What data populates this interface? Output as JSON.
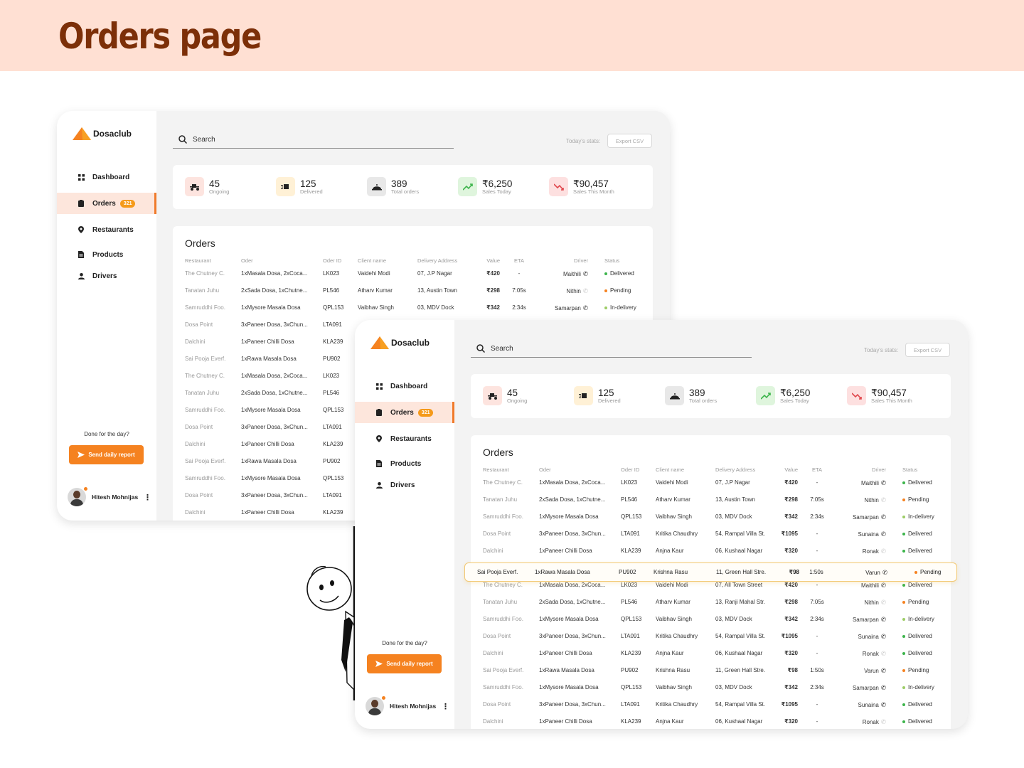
{
  "page_title": "Orders page",
  "app": {
    "brand": "Dosaclub",
    "search_placeholder": "Search",
    "stats_label": "Today's stats:",
    "export_label": "Export CSV",
    "done_text": "Done for the day?",
    "report_label": "Send daily report",
    "user_name": "Hitesh Mohnijas",
    "nav": [
      {
        "label": "Dashboard",
        "icon": "grid-icon"
      },
      {
        "label": "Orders",
        "icon": "clipboard-icon",
        "badge": "321"
      },
      {
        "label": "Restaurants",
        "icon": "location-pin-icon"
      },
      {
        "label": "Products",
        "icon": "document-icon"
      },
      {
        "label": "Drivers",
        "icon": "person-icon"
      }
    ],
    "stats": [
      {
        "value": "45",
        "label": "Ongoing",
        "icon": "scooter-icon",
        "bg": "#fde4df"
      },
      {
        "value": "125",
        "label": "Delivered",
        "icon": "delivery-box-icon",
        "bg": "#fff1d6"
      },
      {
        "value": "389",
        "label": "Total orders",
        "icon": "cloche-icon",
        "bg": "#e8e8e8"
      },
      {
        "value": "₹6,250",
        "label": "Sales Today",
        "icon": "trend-up-icon",
        "bg": "#dff5dd"
      },
      {
        "value": "₹90,457",
        "label": "Sales This Month",
        "icon": "trend-down-icon",
        "bg": "#fde0e0"
      }
    ],
    "orders_title": "Orders",
    "columns": [
      "Restaurant",
      "Oder",
      "Oder ID",
      "Client name",
      "Delivery Address",
      "Value",
      "ETA",
      "Driver",
      "Status"
    ],
    "status_colors": {
      "Delivered": "#3cb44b",
      "Pending": "#f58220",
      "In-delivery": "#9ccc65"
    }
  },
  "window1_rows": [
    {
      "restaurant": "The Chutney C.",
      "order": "1xMasala Dosa, 2xCoca...",
      "id": "LK023",
      "client": "Vaidehi Modi",
      "address": "07, J.P Nagar",
      "value": "₹420",
      "eta": "-",
      "driver": "Maithili",
      "phone_active": true,
      "status": "Delivered"
    },
    {
      "restaurant": "Tanatan Juhu",
      "order": "2xSada Dosa, 1xChutne...",
      "id": "PL546",
      "client": "Atharv Kumar",
      "address": "13, Austin Town",
      "value": "₹298",
      "eta": "7:05s",
      "driver": "Nithin",
      "phone_active": false,
      "status": "Pending"
    },
    {
      "restaurant": "Samruddhi Foo.",
      "order": "1xMysore Masala Dosa",
      "id": "QPL153",
      "client": "Vaibhav Singh",
      "address": "03, MDV Dock",
      "value": "₹342",
      "eta": "2:34s",
      "driver": "Samarpan",
      "phone_active": true,
      "status": "In-delivery"
    },
    {
      "restaurant": "Dosa Point",
      "order": "3xPaneer Dosa, 3xChun...",
      "id": "LTA091"
    },
    {
      "restaurant": "Dalchini",
      "order": "1xPaneer Chilli Dosa",
      "id": "KLA239"
    },
    {
      "restaurant": "Sai Pooja Everf.",
      "order": "1xRawa Masala Dosa",
      "id": "PU902"
    },
    {
      "restaurant": "The Chutney C.",
      "order": "1xMasala Dosa, 2xCoca...",
      "id": "LK023"
    },
    {
      "restaurant": "Tanatan Juhu",
      "order": "2xSada Dosa, 1xChutne...",
      "id": "PL546"
    },
    {
      "restaurant": "Samruddhi Foo.",
      "order": "1xMysore Masala Dosa",
      "id": "QPL153"
    },
    {
      "restaurant": "Dosa Point",
      "order": "3xPaneer Dosa, 3xChun...",
      "id": "LTA091"
    },
    {
      "restaurant": "Dalchini",
      "order": "1xPaneer Chilli Dosa",
      "id": "KLA239"
    },
    {
      "restaurant": "Sai Pooja Everf.",
      "order": "1xRawa Masala Dosa",
      "id": "PU902"
    },
    {
      "restaurant": "Samruddhi Foo.",
      "order": "1xMysore Masala Dosa",
      "id": "QPL153"
    },
    {
      "restaurant": "Dosa Point",
      "order": "3xPaneer Dosa, 3xChun...",
      "id": "LTA091"
    },
    {
      "restaurant": "Dalchini",
      "order": "1xPaneer Chilli Dosa",
      "id": "KLA239"
    }
  ],
  "window2_rows": [
    {
      "restaurant": "The Chutney C.",
      "order": "1xMasala Dosa, 2xCoca...",
      "id": "LK023",
      "client": "Vaidehi Modi",
      "address": "07, J.P Nagar",
      "value": "₹420",
      "eta": "-",
      "driver": "Maithili",
      "phone_active": true,
      "status": "Delivered"
    },
    {
      "restaurant": "Tanatan Juhu",
      "order": "2xSada Dosa, 1xChutne...",
      "id": "PL546",
      "client": "Atharv Kumar",
      "address": "13, Austin Town",
      "value": "₹298",
      "eta": "7:05s",
      "driver": "Nithin",
      "phone_active": false,
      "status": "Pending"
    },
    {
      "restaurant": "Samruddhi Foo.",
      "order": "1xMysore Masala Dosa",
      "id": "QPL153",
      "client": "Vaibhav Singh",
      "address": "03, MDV Dock",
      "value": "₹342",
      "eta": "2:34s",
      "driver": "Samarpan",
      "phone_active": true,
      "status": "In-delivery"
    },
    {
      "restaurant": "Dosa Point",
      "order": "3xPaneer Dosa, 3xChun...",
      "id": "LTA091",
      "client": "Kritika Chaudhry",
      "address": "54, Rampal Villa St.",
      "value": "₹1095",
      "eta": "-",
      "driver": "Sunaina",
      "phone_active": true,
      "status": "Delivered"
    },
    {
      "restaurant": "Dalchini",
      "order": "1xPaneer Chilli Dosa",
      "id": "KLA239",
      "client": "Anjna Kaur",
      "address": "06, Kushaal Nagar",
      "value": "₹320",
      "eta": "-",
      "driver": "Ronak",
      "phone_active": false,
      "status": "Delivered"
    },
    {
      "restaurant": "",
      "order": "",
      "id": "",
      "client": "",
      "address": "",
      "value": "",
      "eta": "",
      "driver": "",
      "status": ""
    },
    {
      "restaurant": "The Chutney C.",
      "order": "1xMasala Dosa, 2xCoca...",
      "id": "LK023",
      "client": "Vaidehi Modi",
      "address": "07, All Town Street",
      "value": "₹420",
      "eta": "-",
      "driver": "Maithili",
      "phone_active": true,
      "status": "Delivered"
    },
    {
      "restaurant": "Tanatan Juhu",
      "order": "2xSada Dosa, 1xChutne...",
      "id": "PL546",
      "client": "Atharv Kumar",
      "address": "13, Ranji Mahal Str.",
      "value": "₹298",
      "eta": "7:05s",
      "driver": "Nithin",
      "phone_active": false,
      "status": "Pending"
    },
    {
      "restaurant": "Samruddhi Foo.",
      "order": "1xMysore Masala Dosa",
      "id": "QPL153",
      "client": "Vaibhav Singh",
      "address": "03, MDV Dock",
      "value": "₹342",
      "eta": "2:34s",
      "driver": "Samarpan",
      "phone_active": true,
      "status": "In-delivery"
    },
    {
      "restaurant": "Dosa Point",
      "order": "3xPaneer Dosa, 3xChun...",
      "id": "LTA091",
      "client": "Kritika Chaudhry",
      "address": "54, Rampal Villa St.",
      "value": "₹1095",
      "eta": "-",
      "driver": "Sunaina",
      "phone_active": true,
      "status": "Delivered"
    },
    {
      "restaurant": "Dalchini",
      "order": "1xPaneer Chilli Dosa",
      "id": "KLA239",
      "client": "Anjna Kaur",
      "address": "06, Kushaal Nagar",
      "value": "₹320",
      "eta": "-",
      "driver": "Ronak",
      "phone_active": false,
      "status": "Delivered"
    },
    {
      "restaurant": "Sai Pooja Everf.",
      "order": "1xRawa Masala Dosa",
      "id": "PU902",
      "client": "Krishna Rasu",
      "address": "11, Green Hall Stre.",
      "value": "₹98",
      "eta": "1:50s",
      "driver": "Varun",
      "phone_active": true,
      "status": "Pending"
    },
    {
      "restaurant": "Samruddhi Foo.",
      "order": "1xMysore Masala Dosa",
      "id": "QPL153",
      "client": "Vaibhav Singh",
      "address": "03, MDV Dock",
      "value": "₹342",
      "eta": "2:34s",
      "driver": "Samarpan",
      "phone_active": true,
      "status": "In-delivery"
    },
    {
      "restaurant": "Dosa Point",
      "order": "3xPaneer Dosa, 3xChun...",
      "id": "LTA091",
      "client": "Kritika Chaudhry",
      "address": "54, Rampal Villa St.",
      "value": "₹1095",
      "eta": "-",
      "driver": "Sunaina",
      "phone_active": true,
      "status": "Delivered"
    },
    {
      "restaurant": "Dalchini",
      "order": "1xPaneer Chilli Dosa",
      "id": "KLA239",
      "client": "Anjna Kaur",
      "address": "06, Kushaal Nagar",
      "value": "₹320",
      "eta": "-",
      "driver": "Ronak",
      "phone_active": false,
      "status": "Delivered"
    }
  ],
  "highlighted_row": {
    "restaurant": "Sai Pooja Everf.",
    "order": "1xRawa Masala Dosa",
    "id": "PU902",
    "client": "Krishna Rasu",
    "address": "11, Green Hall Stre.",
    "value": "₹98",
    "eta": "1:50s",
    "driver": "Varun",
    "status": "Pending"
  }
}
